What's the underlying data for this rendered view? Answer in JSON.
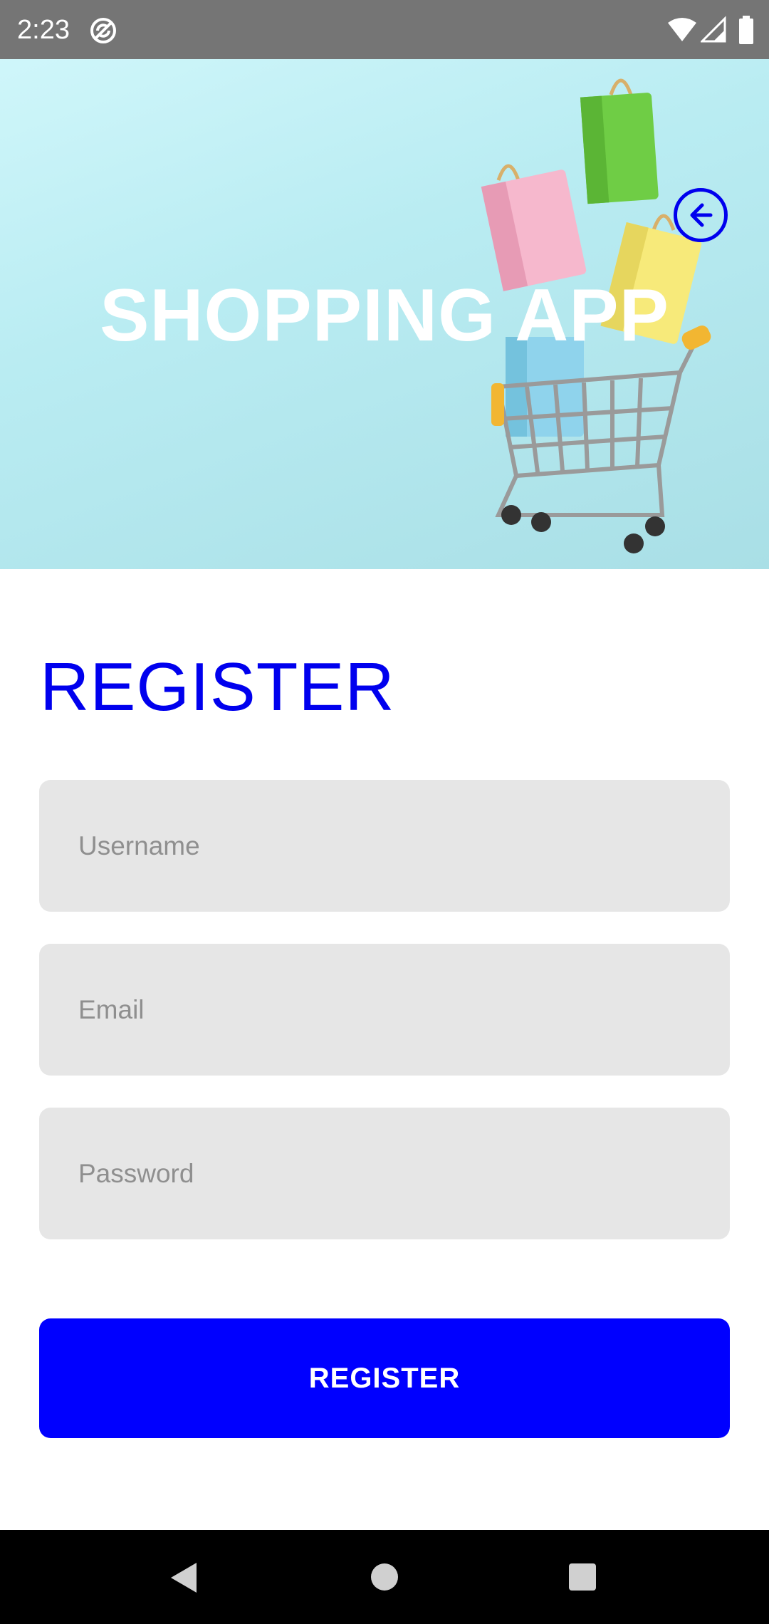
{
  "status_bar": {
    "time": "2:23",
    "icons": [
      "sync-icon",
      "wifi-icon",
      "signal-icon",
      "battery-icon"
    ]
  },
  "hero": {
    "title": "SHOPPING APP",
    "back_icon": "arrow-left-circle-icon",
    "back_color": "#0000ee"
  },
  "form": {
    "heading": "REGISTER",
    "username_placeholder": "Username",
    "email_placeholder": "Email",
    "password_placeholder": "Password",
    "submit_label": "REGISTER"
  },
  "nav_bar": {
    "icons": [
      "nav-back-icon",
      "nav-home-icon",
      "nav-recents-icon"
    ]
  },
  "colors": {
    "accent": "#0000ff",
    "field_bg": "#e6e6e6",
    "status_bar": "#757575"
  }
}
